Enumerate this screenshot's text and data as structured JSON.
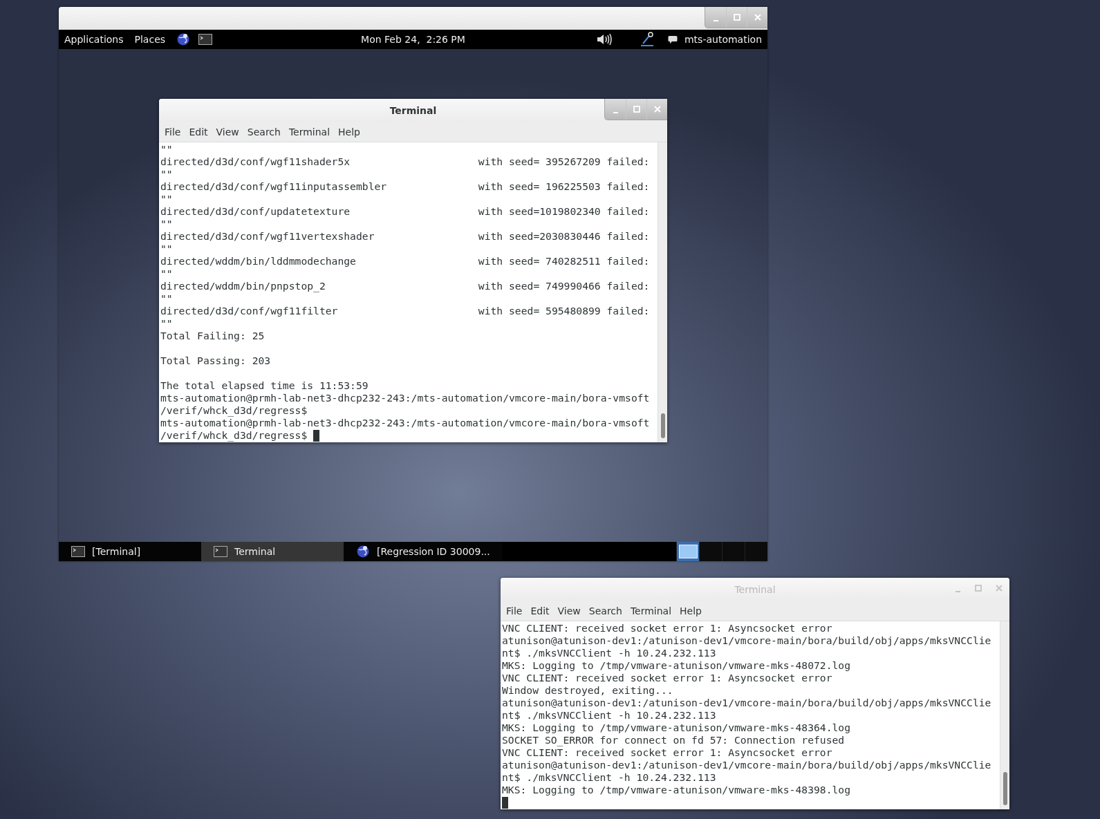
{
  "vnc_window": {
    "focused": true,
    "panel": {
      "menus": [
        "Applications",
        "Places"
      ],
      "launchers": [
        {
          "kind": "globe"
        },
        {
          "kind": "terminal"
        }
      ],
      "clock": "Mon Feb 24,  2:26 PM",
      "user": "mts-automation"
    },
    "terminal": {
      "title": "Terminal",
      "focused": true,
      "menu": [
        "File",
        "Edit",
        "View",
        "Search",
        "Terminal",
        "Help"
      ],
      "cursor": true,
      "lines": [
        {
          "kind": "text",
          "text": "\"\""
        },
        {
          "kind": "result",
          "path": "directed/d3d/conf/wgf11shader5x",
          "result": "with seed= 395267209 failed:"
        },
        {
          "kind": "text",
          "text": "\"\""
        },
        {
          "kind": "result",
          "path": "directed/d3d/conf/wgf11inputassembler",
          "result": "with seed= 196225503 failed:"
        },
        {
          "kind": "text",
          "text": "\"\""
        },
        {
          "kind": "result",
          "path": "directed/d3d/conf/updatetexture",
          "result": "with seed=1019802340 failed:"
        },
        {
          "kind": "text",
          "text": "\"\""
        },
        {
          "kind": "result",
          "path": "directed/d3d/conf/wgf11vertexshader",
          "result": "with seed=2030830446 failed:"
        },
        {
          "kind": "text",
          "text": "\"\""
        },
        {
          "kind": "result",
          "path": "directed/wddm/bin/lddmmodechange",
          "result": "with seed= 740282511 failed:"
        },
        {
          "kind": "text",
          "text": "\"\""
        },
        {
          "kind": "result",
          "path": "directed/wddm/bin/pnpstop_2",
          "result": "with seed= 749990466 failed:"
        },
        {
          "kind": "text",
          "text": "\"\""
        },
        {
          "kind": "result",
          "path": "directed/d3d/conf/wgf11filter",
          "result": "with seed= 595480899 failed:"
        },
        {
          "kind": "text",
          "text": "\"\""
        },
        {
          "kind": "text",
          "text": "Total Failing: 25"
        },
        {
          "kind": "blank"
        },
        {
          "kind": "text",
          "text": "Total Passing: 203"
        },
        {
          "kind": "blank"
        },
        {
          "kind": "text",
          "text": "The total elapsed time is 11:53:59"
        },
        {
          "kind": "text",
          "text": "mts-automation@prmh-lab-net3-dhcp232-243:/mts-automation/vmcore-main/bora-vmsoft"
        },
        {
          "kind": "text",
          "text": "/verif/whck_d3d/regress$"
        },
        {
          "kind": "text",
          "text": "mts-automation@prmh-lab-net3-dhcp232-243:/mts-automation/vmcore-main/bora-vmsoft"
        },
        {
          "kind": "text",
          "text": "/verif/whck_d3d/regress$ "
        }
      ]
    },
    "taskbar": [
      {
        "label": "[Terminal]",
        "kind": "terminal",
        "selected": false
      },
      {
        "label": "Terminal",
        "kind": "terminal",
        "selected": true
      },
      {
        "label": "[Regression ID 30009...",
        "kind": "globe",
        "selected": false
      }
    ],
    "workspaces": [
      {
        "selected": true
      },
      {
        "selected": false
      },
      {
        "selected": false
      },
      {
        "selected": false
      }
    ]
  },
  "terminal_2": {
    "title": "Terminal",
    "focused": false,
    "menu": [
      "File",
      "Edit",
      "View",
      "Search",
      "Terminal",
      "Help"
    ],
    "cursor": true,
    "lines": [
      {
        "kind": "text",
        "text": "VNC CLIENT: received socket error 1: Asyncsocket error"
      },
      {
        "kind": "text",
        "text": "atunison@atunison-dev1:/atunison-dev1/vmcore-main/bora/build/obj/apps/mksVNCClie"
      },
      {
        "kind": "text",
        "text": "nt$ ./mksVNCClient -h 10.24.232.113"
      },
      {
        "kind": "text",
        "text": "MKS: Logging to /tmp/vmware-atunison/vmware-mks-48072.log"
      },
      {
        "kind": "text",
        "text": "VNC CLIENT: received socket error 1: Asyncsocket error"
      },
      {
        "kind": "text",
        "text": "Window destroyed, exiting..."
      },
      {
        "kind": "text",
        "text": "atunison@atunison-dev1:/atunison-dev1/vmcore-main/bora/build/obj/apps/mksVNCClie"
      },
      {
        "kind": "text",
        "text": "nt$ ./mksVNCClient -h 10.24.232.113"
      },
      {
        "kind": "text",
        "text": "MKS: Logging to /tmp/vmware-atunison/vmware-mks-48364.log"
      },
      {
        "kind": "text",
        "text": "SOCKET SO_ERROR for connect on fd 57: Connection refused"
      },
      {
        "kind": "text",
        "text": "VNC CLIENT: received socket error 1: Asyncsocket error"
      },
      {
        "kind": "text",
        "text": "atunison@atunison-dev1:/atunison-dev1/vmcore-main/bora/build/obj/apps/mksVNCClie"
      },
      {
        "kind": "text",
        "text": "nt$ ./mksVNCClient -h 10.24.232.113"
      },
      {
        "kind": "text",
        "text": "MKS: Logging to /tmp/vmware-atunison/vmware-mks-48398.log"
      },
      {
        "kind": "blank"
      }
    ]
  }
}
